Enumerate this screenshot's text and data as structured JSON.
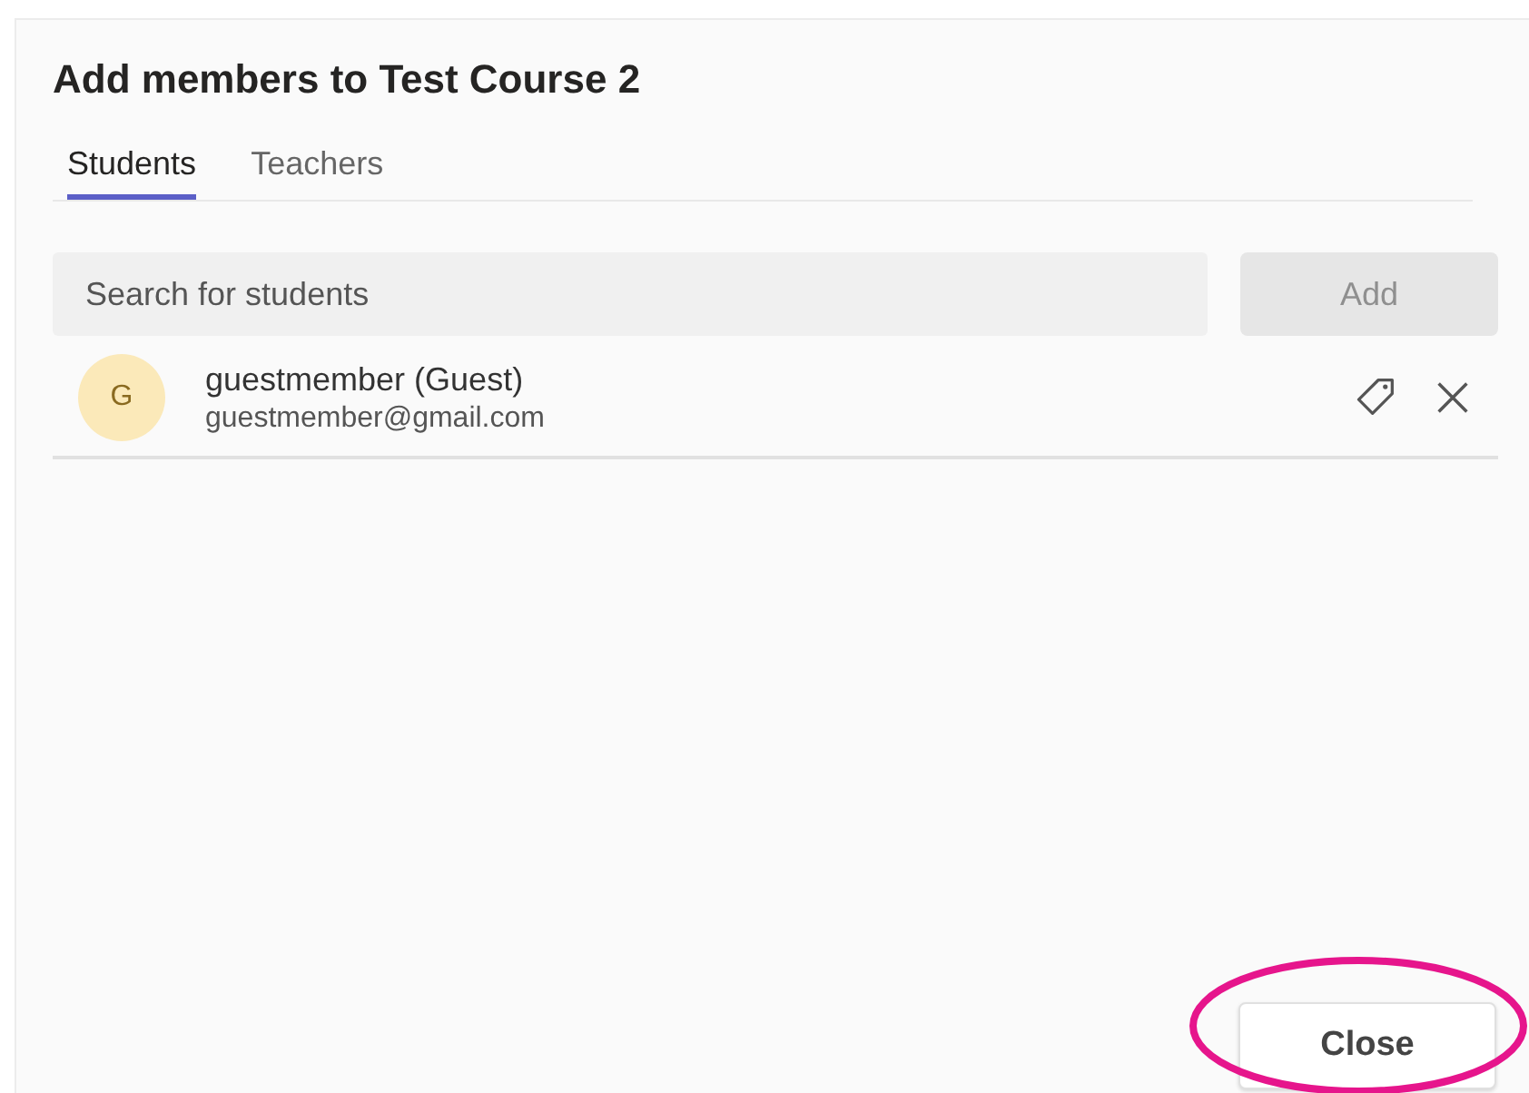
{
  "dialog": {
    "title": "Add members to Test Course 2"
  },
  "tabs": [
    {
      "label": "Students",
      "selected": true
    },
    {
      "label": "Teachers",
      "selected": false
    }
  ],
  "search": {
    "placeholder": "Search for students"
  },
  "add_button": {
    "label": "Add",
    "disabled": true
  },
  "members": [
    {
      "initial": "G",
      "name": "guestmember (Guest)",
      "email": "guestmember@gmail.com"
    }
  ],
  "close_button": {
    "label": "Close"
  },
  "annotation": {
    "kind": "ellipse",
    "color": "#e6158c"
  }
}
